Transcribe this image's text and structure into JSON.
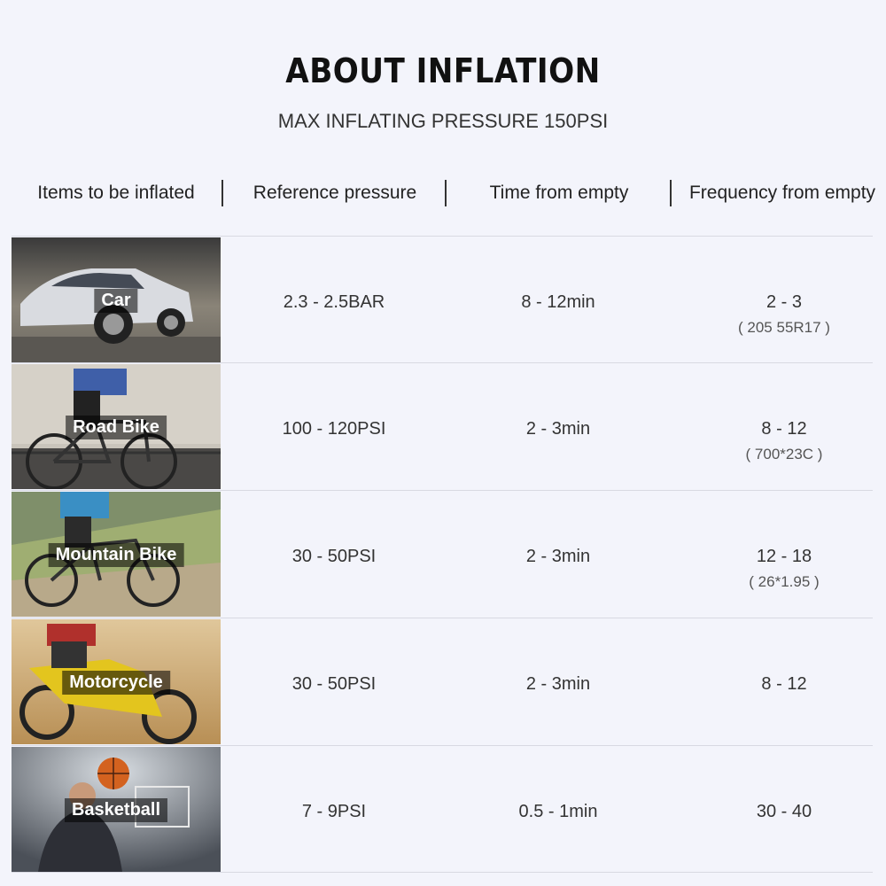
{
  "title": "ABOUT INFLATION",
  "subtitle": "MAX INFLATING PRESSURE 150PSI",
  "headers": [
    "Items to be inflated",
    "Reference pressure",
    "Time from empty",
    "Frequency from empty"
  ],
  "rows": [
    {
      "item": "Car",
      "pressure": "2.3 - 2.5BAR",
      "time": "8 - 12min",
      "frequency": "2 - 3",
      "note": "( 205 55R17 )"
    },
    {
      "item": "Road Bike",
      "pressure": "100 - 120PSI",
      "time": "2 - 3min",
      "frequency": "8 - 12",
      "note": "( 700*23C )"
    },
    {
      "item": "Mountain Bike",
      "pressure": "30 - 50PSI",
      "time": "2 - 3min",
      "frequency": "12 - 18",
      "note": "( 26*1.95 )"
    },
    {
      "item": "Motorcycle",
      "pressure": "30 - 50PSI",
      "time": "2 - 3min",
      "frequency": "8 - 12",
      "note": ""
    },
    {
      "item": "Basketball",
      "pressure": "7 - 9PSI",
      "time": "0.5 - 1min",
      "frequency": "30 - 40",
      "note": ""
    }
  ],
  "colors": {
    "background": "#f3f4fb",
    "text": "#333333",
    "divider": "#d8d9e2"
  }
}
